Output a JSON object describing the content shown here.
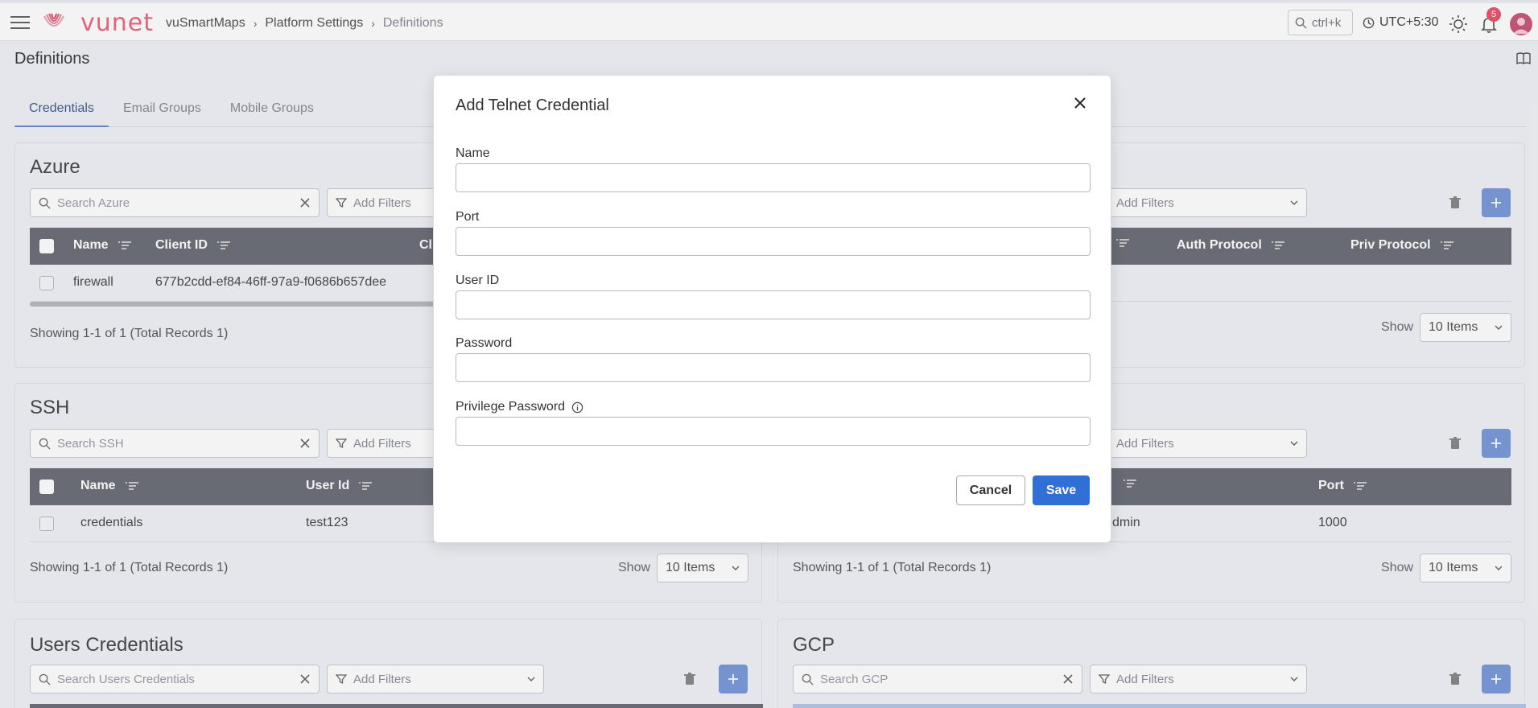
{
  "topbar": {
    "logo_text": "vunet",
    "breadcrumbs": [
      "vuSmartMaps",
      "Platform Settings",
      "Definitions"
    ],
    "search_shortcut": "ctrl+k",
    "timezone": "UTC+5:30",
    "notification_count": "5"
  },
  "page": {
    "title": "Definitions",
    "tabs": [
      "Credentials",
      "Email Groups",
      "Mobile Groups"
    ],
    "active_tab": "Credentials"
  },
  "azure": {
    "title": "Azure",
    "search_placeholder": "Search Azure",
    "filter_label": "Add Filters",
    "columns": [
      "Name",
      "Client ID",
      "Cli"
    ],
    "rows": [
      {
        "name": "firewall",
        "client_id": "677b2cdd-ef84-46ff-97a9-f0686b657dee"
      }
    ],
    "footer": "Showing 1-1 of 1 (Total Records 1)"
  },
  "snmp": {
    "filter_label": "Add Filters",
    "columns": [
      "Auth Protocol",
      "Priv Protocol"
    ],
    "show_label": "Show",
    "items_value": "10 Items"
  },
  "ssh": {
    "title": "SSH",
    "search_placeholder": "Search SSH",
    "filter_label": "Add Filters",
    "columns": [
      "Name",
      "User Id"
    ],
    "rows": [
      {
        "name": "credentials",
        "user_id": "test123"
      }
    ],
    "footer": "Showing 1-1 of 1 (Total Records 1)",
    "show_label": "Show",
    "items_value": "10 Items"
  },
  "telnet": {
    "filter_label": "Add Filters",
    "columns": [
      "Port"
    ],
    "rows": [
      {
        "user_partial": "dmin",
        "port": "1000"
      }
    ],
    "footer": "Showing 1-1 of 1 (Total Records 1)",
    "show_label": "Show",
    "items_value": "10 Items"
  },
  "users_credentials": {
    "title": "Users Credentials",
    "search_placeholder": "Search Users Credentials",
    "filter_label": "Add Filters"
  },
  "gcp": {
    "title": "GCP",
    "search_placeholder": "Search GCP",
    "filter_label": "Add Filters"
  },
  "modal": {
    "title": "Add Telnet Credential",
    "fields": [
      {
        "label": "Name",
        "value": ""
      },
      {
        "label": "Port",
        "value": ""
      },
      {
        "label": "User ID",
        "value": ""
      },
      {
        "label": "Password",
        "value": ""
      },
      {
        "label": "Privilege Password",
        "value": ""
      }
    ],
    "cancel_label": "Cancel",
    "save_label": "Save"
  },
  "colors": {
    "accent": "#2f6fd6",
    "add_button": "#7b9ad8",
    "table_header": "#6e7079",
    "brand": "#e96a82",
    "badge": "#e8566d"
  }
}
